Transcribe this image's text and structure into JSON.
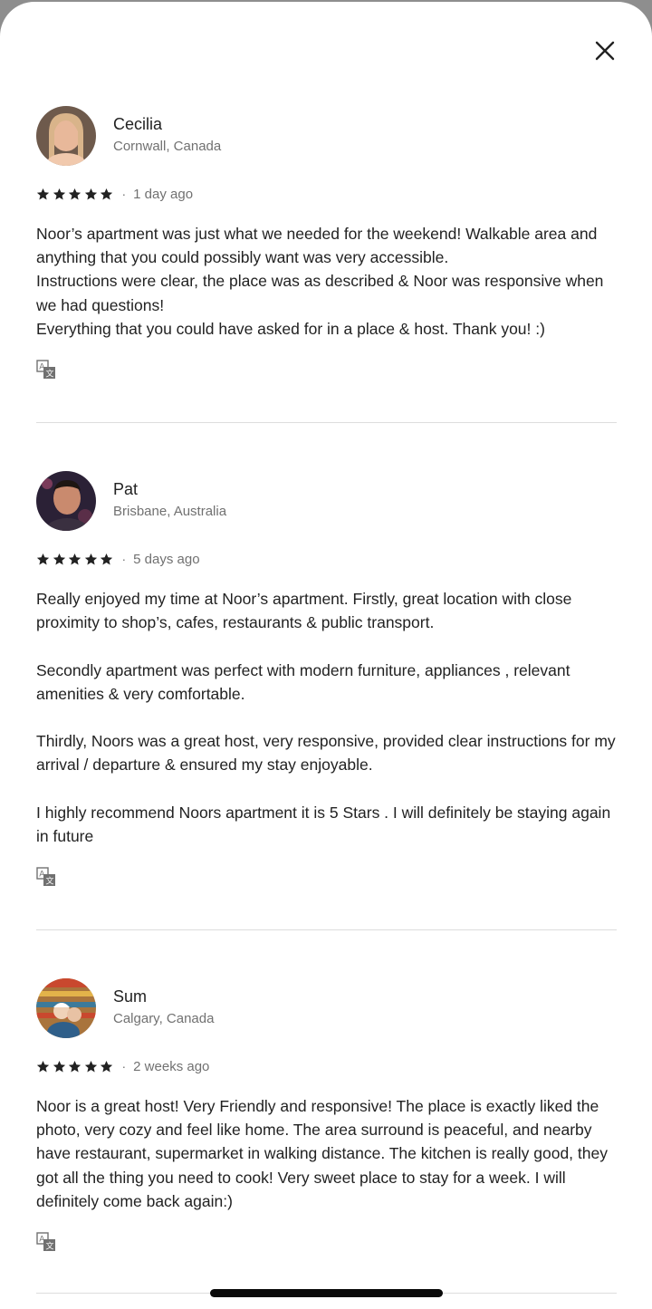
{
  "header": {
    "close_icon": "close-icon"
  },
  "reviews": [
    {
      "name": "Cecilia",
      "location": "Cornwall, Canada",
      "rating": 5,
      "separator": "·",
      "date": "1 day ago",
      "text": "Noor’s apartment was just what we needed for the weekend! Walkable area and anything that you could possibly want was very accessible.\nInstructions were clear, the place was as described & Noor was responsive when we had questions!\nEverything that you could have asked for in a place & host. Thank you! :)",
      "translate_icon": "translate-icon",
      "avatar_colors": [
        "#c99a7a",
        "#e9c2a4"
      ]
    },
    {
      "name": "Pat",
      "location": "Brisbane, Australia",
      "rating": 5,
      "separator": "·",
      "date": "5 days ago",
      "text": "Really enjoyed my time at Noor’s apartment. Firstly, great location with close proximity to shop’s, cafes, restaurants & public transport.\n\nSecondly apartment was perfect with modern furniture, appliances , relevant amenities & very comfortable.\n\nThirdly, Noors was a great host, very responsive, provided clear instructions for my arrival / departure & ensured my stay enjoyable.\n\nI highly recommend Noors apartment it is 5 Stars . I will definitely be staying again in future",
      "translate_icon": "translate-icon",
      "avatar_colors": [
        "#3b2f4a",
        "#c9886f"
      ]
    },
    {
      "name": "Sum",
      "location": "Calgary, Canada",
      "rating": 5,
      "separator": "·",
      "date": "2 weeks ago",
      "text": "Noor is a great host! Very Friendly and responsive! The place is exactly liked the photo, very cozy and feel like home. The area surround is peaceful, and nearby have restaurant, supermarket in walking distance. The kitchen is really good, they got all the thing you need to cook! Very sweet place to stay for a week. I will definitely come back again:)",
      "translate_icon": "translate-icon",
      "avatar_colors": [
        "#b07a3e",
        "#3f6e8c"
      ]
    }
  ]
}
